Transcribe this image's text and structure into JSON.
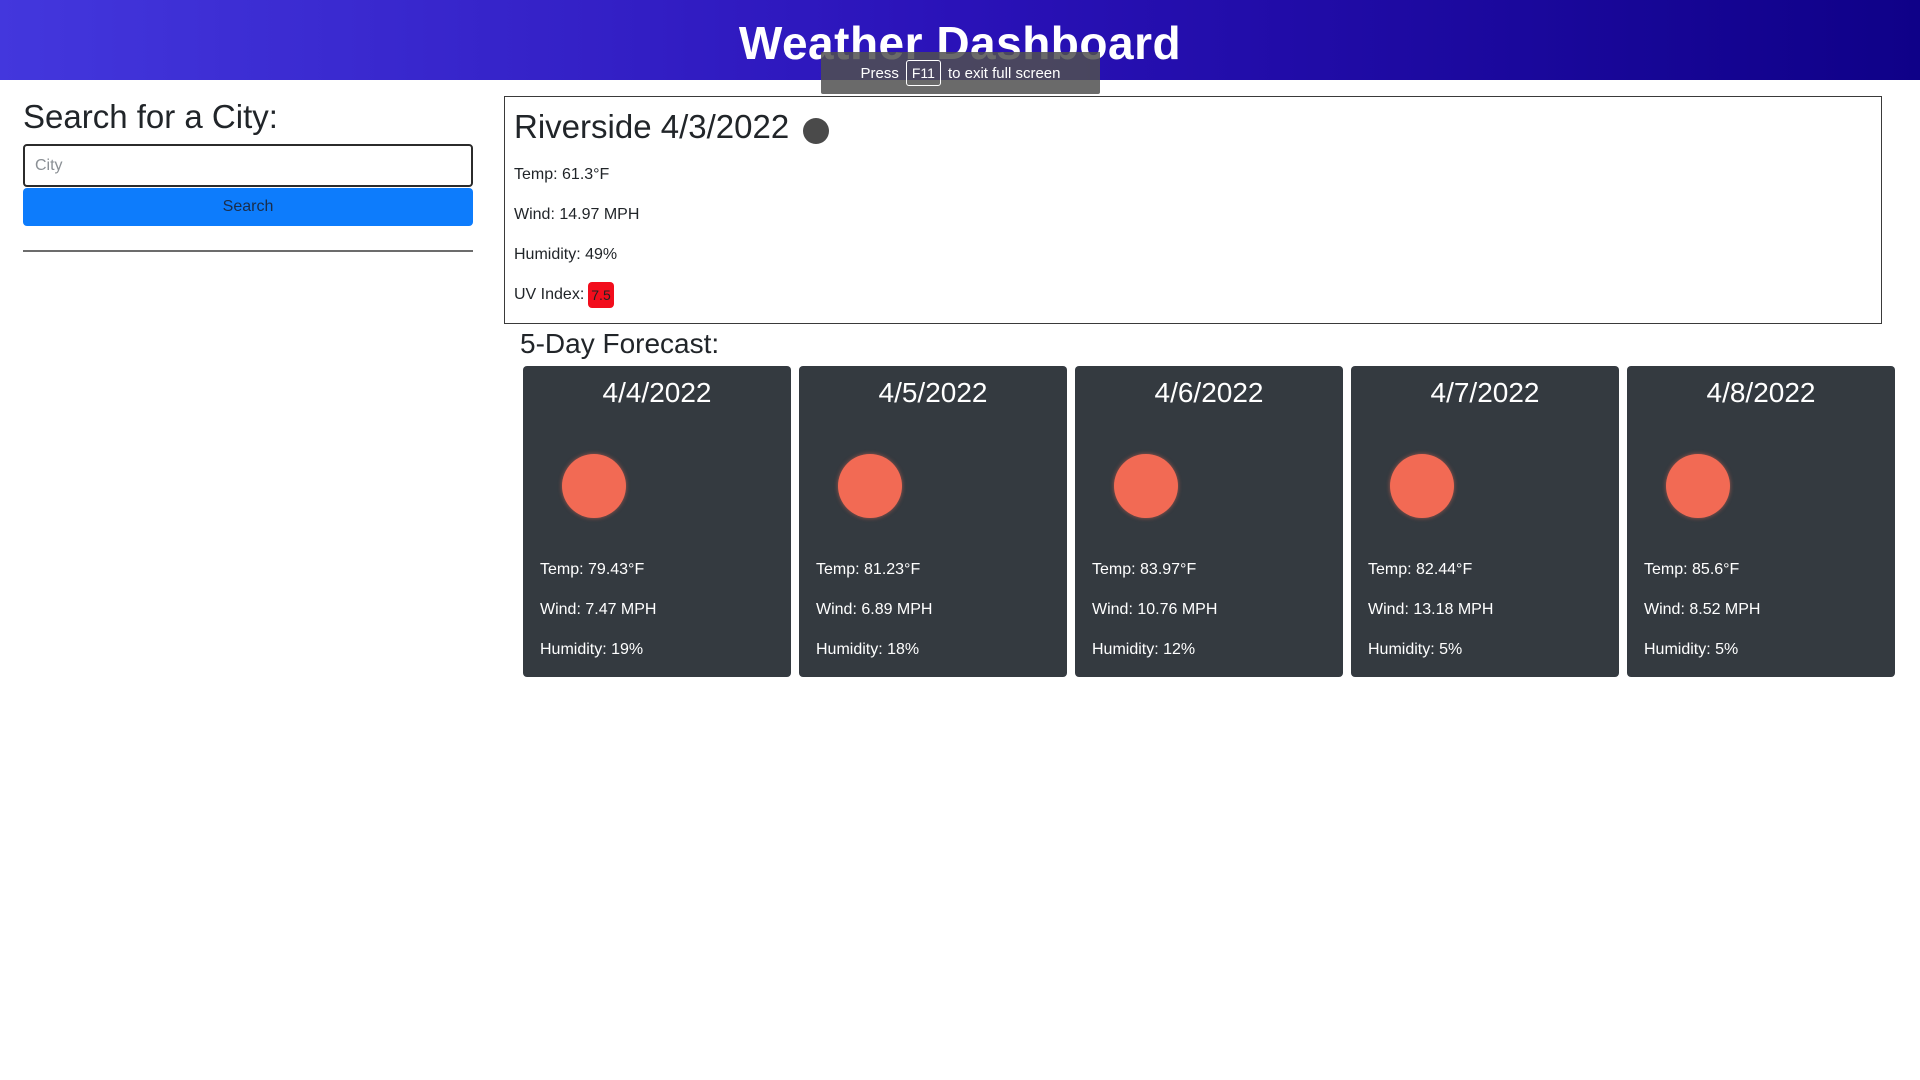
{
  "header": {
    "title": "Weather Dashboard"
  },
  "fullscreen_toast": {
    "prefix": "Press",
    "key": "F11",
    "suffix": "to exit full screen"
  },
  "search": {
    "heading": "Search for a City:",
    "placeholder": "City",
    "value": "",
    "button_label": "Search"
  },
  "current": {
    "title": "Riverside 4/3/2022",
    "icon": "weather-icon",
    "temp": "Temp: 61.3°F",
    "wind": "Wind: 14.97 MPH",
    "humidity": "Humidity: 49%",
    "uv_label": "UV Index:",
    "uv_value": "7.5",
    "uv_color": "#f20d1c"
  },
  "forecast": {
    "heading": "5-Day Forecast:",
    "days": [
      {
        "date": "4/4/2022",
        "icon": "sun-icon",
        "temp": "Temp: 79.43°F",
        "wind": "Wind: 7.47 MPH",
        "humidity": "Humidity: 19%"
      },
      {
        "date": "4/5/2022",
        "icon": "sun-icon",
        "temp": "Temp: 81.23°F",
        "wind": "Wind: 6.89 MPH",
        "humidity": "Humidity: 18%"
      },
      {
        "date": "4/6/2022",
        "icon": "sun-icon",
        "temp": "Temp: 83.97°F",
        "wind": "Wind: 10.76 MPH",
        "humidity": "Humidity: 12%"
      },
      {
        "date": "4/7/2022",
        "icon": "sun-icon",
        "temp": "Temp: 82.44°F",
        "wind": "Wind: 13.18 MPH",
        "humidity": "Humidity: 5%"
      },
      {
        "date": "4/8/2022",
        "icon": "sun-icon",
        "temp": "Temp: 85.6°F",
        "wind": "Wind: 8.52 MPH",
        "humidity": "Humidity: 5%"
      }
    ]
  },
  "colors": {
    "header_gradient_start": "#4337dd",
    "header_gradient_end": "#0f0188",
    "button": "#0d7cfc",
    "card_bg": "#343a40",
    "sun": "#f26a54"
  }
}
